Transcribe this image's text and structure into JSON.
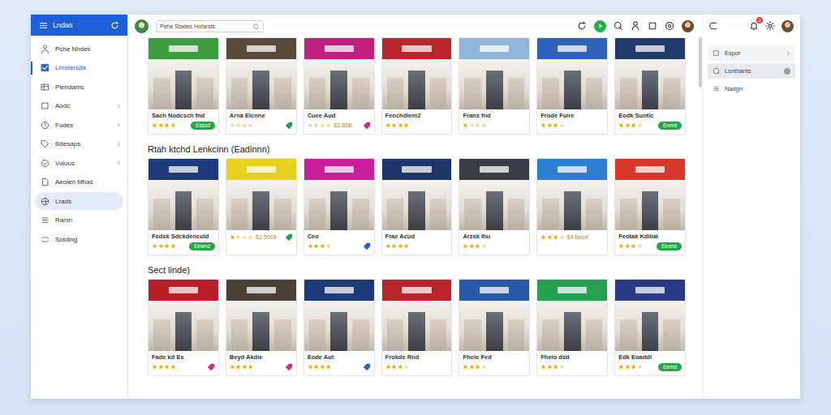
{
  "app": {
    "title": "Lndas"
  },
  "sidebar": {
    "items": [
      {
        "label": "Pche Nhdes",
        "selected": false,
        "highlighted": false,
        "expandable": false
      },
      {
        "label": "Lhndersda",
        "selected": true,
        "highlighted": false,
        "expandable": false
      },
      {
        "label": "Plendams",
        "selected": false,
        "highlighted": false,
        "expandable": false
      },
      {
        "label": "Aodc",
        "selected": false,
        "highlighted": false,
        "expandable": true
      },
      {
        "label": "Fodes",
        "selected": false,
        "highlighted": false,
        "expandable": true
      },
      {
        "label": "Bdesaps",
        "selected": false,
        "highlighted": false,
        "expandable": true
      },
      {
        "label": "Volous",
        "selected": false,
        "highlighted": false,
        "expandable": true
      },
      {
        "label": "Aeolen Mhas",
        "selected": false,
        "highlighted": false,
        "expandable": false
      },
      {
        "label": "Lrads",
        "selected": false,
        "highlighted": true,
        "expandable": false
      },
      {
        "label": "Ranin",
        "selected": false,
        "highlighted": false,
        "expandable": false
      },
      {
        "label": "Sotding",
        "selected": false,
        "highlighted": false,
        "expandable": false
      }
    ]
  },
  "search": {
    "value": "Pehe Stades Hofarsts"
  },
  "sections": [
    {
      "title": "",
      "cards": [
        {
          "name": "Sach Nodcsch fnd",
          "price": "",
          "stars": 4,
          "color": "#3c9a3e",
          "action": {
            "kind": "badge",
            "label": "Essxd",
            "color": "#1fa84a"
          }
        },
        {
          "name": "Arna Elcnne",
          "price": "",
          "stars": 0,
          "color": "#5a4a3a",
          "action": {
            "kind": "tag",
            "label": "",
            "color": "#22a24c"
          }
        },
        {
          "name": "Cuee Aud",
          "price": "$3.B5B",
          "stars": 0,
          "color": "#c0207e",
          "action": {
            "kind": "tag",
            "label": "",
            "color": "#e0287a"
          }
        },
        {
          "name": "Fenchdiem2",
          "price": "",
          "stars": 4,
          "color": "#b8262b",
          "action": {
            "kind": "none",
            "label": "",
            "color": "#ffffff"
          }
        },
        {
          "name": "Frans fnd",
          "price": "",
          "stars": 1,
          "color": "#8fb4d8",
          "action": {
            "kind": "none",
            "label": "",
            "color": "#ffffff"
          }
        },
        {
          "name": "Frode Fuire",
          "price": "",
          "stars": 3,
          "color": "#2f62b8",
          "action": {
            "kind": "none",
            "label": "",
            "color": "#ffffff"
          }
        },
        {
          "name": "Eodk Suntic",
          "price": "",
          "stars": 3,
          "color": "#233a6e",
          "action": {
            "kind": "badge",
            "label": "Enmd",
            "color": "#1fa84a"
          }
        }
      ]
    },
    {
      "title": "Rtah ktchd Lenkcinn (Eadinnn)",
      "cards": [
        {
          "name": "Fsdsk Sdckdenculd",
          "price": "",
          "stars": 4,
          "color": "#1f3a78",
          "action": {
            "kind": "badge",
            "label": "Eewnd",
            "color": "#1fa84a"
          }
        },
        {
          "name": "",
          "price": "$2.5008",
          "stars": 1,
          "color": "#e6d21e",
          "action": {
            "kind": "tag",
            "label": "",
            "color": "#22a24c"
          }
        },
        {
          "name": "Ceo",
          "price": "",
          "stars": 3,
          "color": "#c8209a",
          "action": {
            "kind": "tag",
            "label": "",
            "color": "#2a62d0"
          }
        },
        {
          "name": "Frae Acud",
          "price": "",
          "stars": 4,
          "color": "#1e3568",
          "action": {
            "kind": "none",
            "label": "",
            "color": "#ffffff"
          }
        },
        {
          "name": "Arzsk Ihu",
          "price": "",
          "stars": 3,
          "color": "#3a3d46",
          "action": {
            "kind": "none",
            "label": "",
            "color": "#ffffff"
          }
        },
        {
          "name": "",
          "price": "$4 Becd",
          "stars": 3,
          "color": "#2c7fd0",
          "action": {
            "kind": "none",
            "label": "",
            "color": "#ffffff"
          }
        },
        {
          "name": "Feotak Kdiiial",
          "price": "",
          "stars": 3,
          "color": "#d8382c",
          "action": {
            "kind": "badge",
            "label": "Eeend",
            "color": "#1fa84a"
          }
        }
      ]
    },
    {
      "title": "Sect linde)",
      "cards": [
        {
          "name": "Fade kd Es",
          "price": "",
          "stars": 4,
          "color": "#b81e2a",
          "action": {
            "kind": "tag",
            "label": "",
            "color": "#e0287a"
          }
        },
        {
          "name": "Beyd Akdie",
          "price": "",
          "stars": 4,
          "color": "#4a4038",
          "action": {
            "kind": "tag",
            "label": "",
            "color": "#e0287a"
          }
        },
        {
          "name": "Eode Aut",
          "price": "",
          "stars": 4,
          "color": "#1f3a78",
          "action": {
            "kind": "tag",
            "label": "",
            "color": "#2a62d0"
          }
        },
        {
          "name": "Frokde Rnd",
          "price": "",
          "stars": 3,
          "color": "#b8262b",
          "action": {
            "kind": "none",
            "label": "",
            "color": "#ffffff"
          }
        },
        {
          "name": "Fhoie Fed",
          "price": "",
          "stars": 3,
          "color": "#2a58a8",
          "action": {
            "kind": "none",
            "label": "",
            "color": "#ffffff"
          }
        },
        {
          "name": "Fheio dsd",
          "price": "",
          "stars": 3,
          "color": "#26a050",
          "action": {
            "kind": "none",
            "label": "",
            "color": "#ffffff"
          }
        },
        {
          "name": "Edk Eoaddl",
          "price": "",
          "stars": 3,
          "color": "#2a3a88",
          "action": {
            "kind": "badge",
            "label": "Eemd",
            "color": "#1fa84a"
          }
        }
      ]
    }
  ],
  "right_panel": {
    "notification_count": "2",
    "items": [
      {
        "label": "Espor",
        "highlighted": false,
        "expandable": true
      },
      {
        "label": "Lsnthants",
        "highlighted": true,
        "expandable": false
      },
      {
        "label": "Nadgn",
        "highlighted": false,
        "expandable": false
      }
    ]
  }
}
